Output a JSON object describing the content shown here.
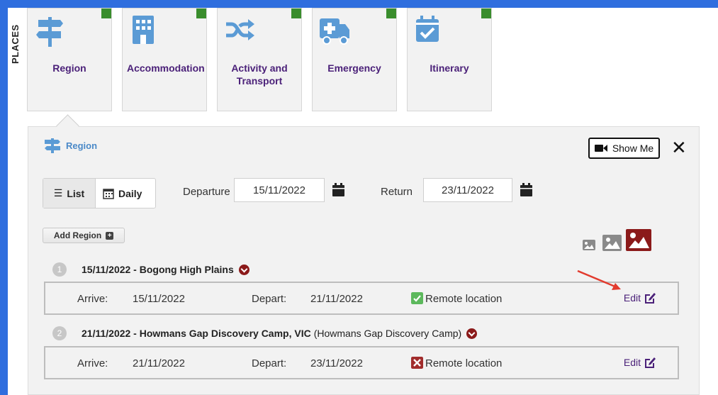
{
  "sidebar": {
    "label": "PLACES"
  },
  "tiles": [
    {
      "label": "Region",
      "icon": "signpost-icon"
    },
    {
      "label": "Accommodation",
      "icon": "hotel-icon"
    },
    {
      "label": "Activity and Transport",
      "icon": "shuffle-icon"
    },
    {
      "label": "Emergency",
      "icon": "ambulance-icon"
    },
    {
      "label": "Itinerary",
      "icon": "calendar-check-icon"
    }
  ],
  "panel": {
    "title": "Region",
    "show_me": "Show Me",
    "close": "✕",
    "view_toggle": {
      "list": "List",
      "daily": "Daily",
      "active": "List"
    },
    "departure_label": "Departure",
    "departure_value": "15/11/2022",
    "return_label": "Return",
    "return_value": "23/11/2022",
    "add_button": "Add Region"
  },
  "regions": [
    {
      "num": "1",
      "title": "15/11/2022 - Bogong High Plains",
      "subtitle": "",
      "arrive_label": "Arrive:",
      "arrive": "15/11/2022",
      "depart_label": "Depart:",
      "depart": "21/11/2022",
      "remote_label": "Remote location",
      "remote": true,
      "edit": "Edit"
    },
    {
      "num": "2",
      "title": "21/11/2022 - Howmans Gap Discovery Camp, VIC",
      "subtitle": "(Howmans Gap Discovery Camp)",
      "arrive_label": "Arrive:",
      "arrive": "21/11/2022",
      "depart_label": "Depart:",
      "depart": "23/11/2022",
      "remote_label": "Remote location",
      "remote": false,
      "edit": "Edit"
    }
  ],
  "colors": {
    "accent_blue": "#2f6ede",
    "tile_label": "#4b2179",
    "tile_corner": "#3a8d2d",
    "icon_blue": "#5b9bd5",
    "check_green": "#5cb85c",
    "cross_red": "#a12c2c",
    "chevron": "#8b1a1a",
    "annotation_arrow": "#e23b2e"
  }
}
